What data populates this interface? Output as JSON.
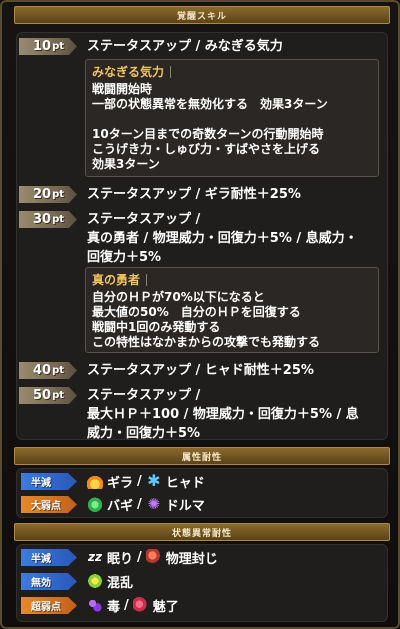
{
  "headers": {
    "awakening_skill": "覚醒スキル",
    "element_resist": "属性耐性",
    "status_resist": "状態異常耐性"
  },
  "skills": [
    {
      "pt_value": "10",
      "pt_unit": "pt",
      "lines": [
        "ステータスアップ / みなぎる気力"
      ]
    },
    {
      "pt_value": "20",
      "pt_unit": "pt",
      "lines": [
        "ステータスアップ / ギラ耐性＋25%"
      ]
    },
    {
      "pt_value": "30",
      "pt_unit": "pt",
      "lines": [
        "ステータスアップ /",
        "真の勇者 / 物理威力・回復力＋5% / 息威力・",
        "回復力＋5%"
      ]
    },
    {
      "pt_value": "40",
      "pt_unit": "pt",
      "lines": [
        "ステータスアップ / ヒャド耐性＋25%"
      ]
    },
    {
      "pt_value": "50",
      "pt_unit": "pt",
      "lines": [
        "ステータスアップ /",
        "最大ＨＰ＋100 / 物理威力・回復力＋5% / 息",
        "威力・回復力＋5%"
      ]
    }
  ],
  "descriptions": {
    "minagiru": {
      "title": "みなぎる気力",
      "lines": [
        "戦闘開始時",
        "一部の状態異常を無効化する　効果3ターン",
        "",
        "10ターン目までの奇数ターンの行動開始時",
        "こうげき力・しゅび力・すばやさを上げる",
        "効果3ターン"
      ]
    },
    "shin_no_yusha": {
      "title": "真の勇者",
      "lines": [
        "自分のＨＰが70%以下になると",
        "最大値の50%　自分のＨＰを回復する",
        "戦闘中1回のみ発動する",
        "この特性はなかまからの攻撃でも発動する"
      ]
    }
  },
  "element_resist": [
    {
      "tag": "半減",
      "tag_color": "#3c7be0",
      "items": [
        {
          "icon": "fire-icon",
          "label": "ギラ"
        },
        {
          "icon": "snowflake-icon",
          "label": "ヒャド"
        }
      ]
    },
    {
      "tag": "大弱点",
      "tag_color": "#e58a2a",
      "items": [
        {
          "icon": "wind-icon",
          "label": "バギ"
        },
        {
          "icon": "dark-swirl-icon",
          "label": "ドルマ"
        }
      ]
    }
  ],
  "status_resist": [
    {
      "tag": "半減",
      "tag_color": "#3c7be0",
      "items": [
        {
          "icon": "sleep-icon",
          "label": "眠り"
        },
        {
          "icon": "physical-seal-icon",
          "label": "物理封じ"
        }
      ]
    },
    {
      "tag": "無効",
      "tag_color": "#3c7be0",
      "items": [
        {
          "icon": "confusion-icon",
          "label": "混乱"
        }
      ]
    },
    {
      "tag": "超弱点",
      "tag_color": "#e58a2a",
      "items": [
        {
          "icon": "poison-icon",
          "label": "毒"
        },
        {
          "icon": "charm-icon",
          "label": "魅了"
        }
      ]
    }
  ],
  "separator": "/"
}
